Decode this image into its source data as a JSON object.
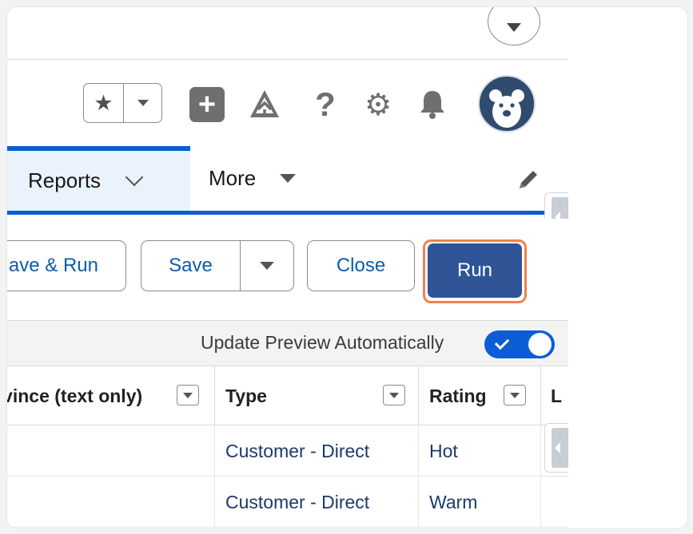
{
  "header": {
    "favorites_star": "★",
    "help_glyph": "?",
    "settings_glyph": "⚙"
  },
  "nav": {
    "active_tab": "Reports",
    "more_label": "More"
  },
  "actions": {
    "save_and_run_label": "ave & Run",
    "save_label": "Save",
    "close_label": "Close",
    "run_label": "Run"
  },
  "preview": {
    "label": "Update Preview Automatically",
    "toggle_on": true
  },
  "table": {
    "columns": [
      {
        "label": "ovince (text only)"
      },
      {
        "label": "Type"
      },
      {
        "label": "Rating"
      },
      {
        "label": "L"
      }
    ],
    "rows": [
      {
        "state": "",
        "type": "Customer - Direct",
        "rating": "Hot",
        "last": ""
      },
      {
        "state": "",
        "type": "Customer - Direct",
        "rating": "Warm",
        "last": ""
      }
    ]
  },
  "colors": {
    "accent_blue": "#0b5cd5",
    "run_button": "#2f5597",
    "highlight_ring": "#f0824f",
    "link_text": "#0b5cab"
  }
}
